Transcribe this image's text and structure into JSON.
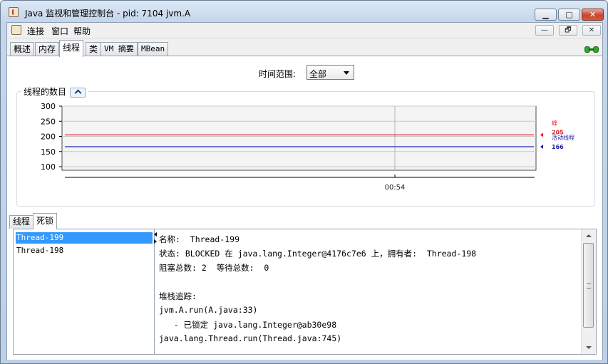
{
  "window": {
    "title": "Java 监视和管理控制台 - pid: 7104 jvm.A"
  },
  "window_controls": {
    "minimize": "▁",
    "maximize": "▢",
    "close": "✕"
  },
  "menu": {
    "items": [
      "连接",
      "窗口",
      "帮助"
    ],
    "inner_controls": [
      "—",
      "🗗",
      "✕"
    ]
  },
  "tabs": [
    {
      "label": "概述"
    },
    {
      "label": "内存"
    },
    {
      "label": "线程",
      "active": true
    },
    {
      "label": "类"
    },
    {
      "label": "VM 摘要"
    },
    {
      "label": "MBean"
    }
  ],
  "time_range": {
    "label": "时间范围:",
    "value": "全部"
  },
  "chart_group": {
    "title": "线程的数目"
  },
  "chart_data": {
    "type": "line",
    "y_ticks": [
      100,
      150,
      200,
      250,
      300
    ],
    "ylim": [
      100,
      300
    ],
    "x_tick_labels": [
      "00:54"
    ],
    "series": [
      {
        "name": "峰",
        "value": 205,
        "color": "#e31a1a"
      },
      {
        "name": "活动线程",
        "value": 166,
        "color": "#1a1aa8"
      }
    ]
  },
  "subtabs": [
    {
      "label": "线程"
    },
    {
      "label": "死锁",
      "active": true
    }
  ],
  "threads": [
    "Thread-199",
    "Thread-198"
  ],
  "detail": [
    "名称:  Thread-199",
    "状态: BLOCKED 在 java.lang.Integer@4176c7e6 上，拥有者:  Thread-198",
    "阻塞总数: 2  等待总数:  0",
    "",
    "堆栈追踪:",
    "jvm.A.run(A.java:33)",
    "   - 已锁定 java.lang.Integer@ab30e98",
    "java.lang.Thread.run(Thread.java:745)"
  ]
}
